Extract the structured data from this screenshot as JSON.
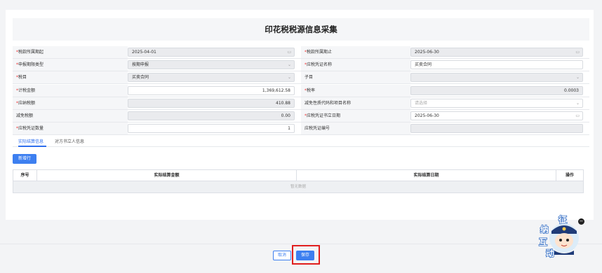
{
  "title": "印花税税源信息采集",
  "rows": [
    {
      "left": {
        "label": "税款所属期起",
        "required": true,
        "value": "2025-04-01",
        "icon": "calendar-icon",
        "disabled": true
      },
      "right": {
        "label": "税款所属期止",
        "required": true,
        "value": "2025-06-30",
        "icon": "calendar-icon",
        "disabled": true
      }
    },
    {
      "left": {
        "label": "申报期限类型",
        "required": true,
        "value": "按期申报",
        "icon": "chevron-down-icon",
        "disabled": true
      },
      "right": {
        "label": "应税凭证名称",
        "required": true,
        "value": "买卖合同",
        "disabled": false
      }
    },
    {
      "left": {
        "label": "税目",
        "required": true,
        "value": "买卖合同",
        "icon": "chevron-down-icon",
        "disabled": true
      },
      "right": {
        "label": "子目",
        "required": false,
        "value": "",
        "icon": "chevron-down-icon",
        "disabled": true
      }
    },
    {
      "left": {
        "label": "计税金额",
        "required": true,
        "value": "1,369,612.58",
        "numeric": true,
        "disabled": false
      },
      "right": {
        "label": "税率",
        "required": true,
        "value": "0.0003",
        "numeric": true,
        "disabled": true
      }
    },
    {
      "left": {
        "label": "应纳税额",
        "required": true,
        "value": "410.88",
        "numeric": true,
        "disabled": true
      },
      "right": {
        "label": "减免性质代码和项目名称",
        "required": false,
        "value": "",
        "placeholder": "请选择",
        "icon": "chevron-down-icon",
        "disabled": false
      }
    },
    {
      "left": {
        "label": "减免税额",
        "required": false,
        "value": "0.00",
        "numeric": true,
        "disabled": true
      },
      "right": {
        "label": "应税凭证书立日期",
        "required": true,
        "value": "2025-06-30",
        "icon": "calendar-icon",
        "disabled": false
      }
    },
    {
      "left": {
        "label": "应税凭证数量",
        "required": true,
        "value": "1",
        "numeric": true,
        "disabled": false
      },
      "right": {
        "label": "应税凭证编号",
        "required": false,
        "value": "",
        "disabled": true
      }
    }
  ],
  "tabs": [
    "实际结算信息",
    "对方书立人信息"
  ],
  "add_row_label": "新增行",
  "table": {
    "columns": [
      "序号",
      "实际结算金额",
      "实际结算日期",
      "操作"
    ],
    "empty_text": "暂无数据"
  },
  "footer": {
    "cancel_label": "取消",
    "save_label": "保存"
  },
  "widget": {
    "chars": [
      "征",
      "纳",
      "互",
      "动"
    ],
    "close_symbol": "−"
  },
  "colors": {
    "accent": "#3d7ff0",
    "required": "#e33333",
    "highlight": "#e01e1e"
  }
}
